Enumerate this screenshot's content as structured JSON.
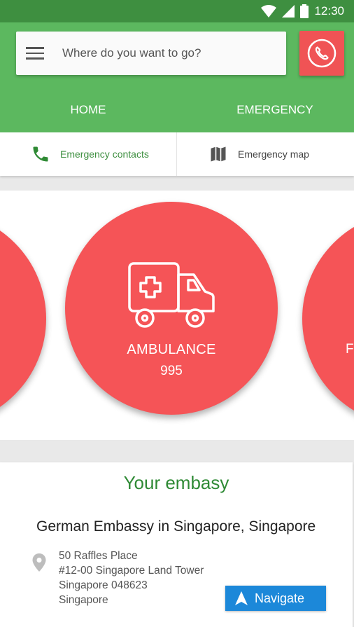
{
  "status_bar": {
    "time": "12:30"
  },
  "search": {
    "placeholder": "Where do you want to go?"
  },
  "tabs": [
    {
      "label": "HOME"
    },
    {
      "label": "EMERGENCY"
    }
  ],
  "subtabs": [
    {
      "label": "Emergency contacts",
      "icon": "phone-icon"
    },
    {
      "label": "Emergency map",
      "icon": "map-icon"
    }
  ],
  "carousel": {
    "main": {
      "label": "AMBULANCE",
      "number": "995",
      "icon": "ambulance-icon"
    },
    "right_partial_text": "F"
  },
  "embassy": {
    "heading": "Your embasy",
    "name": "German Embassy in Singapore, Singapore",
    "address_lines": [
      "50 Raffles Place",
      "#12-00 Singapore Land Tower",
      "Singapore 048623",
      "Singapore"
    ],
    "navigate_label": "Navigate"
  },
  "colors": {
    "primary_green": "#5cb85f",
    "dark_green": "#3e8f40",
    "emergency_red": "#f55457",
    "navigate_blue": "#1c88d9"
  }
}
